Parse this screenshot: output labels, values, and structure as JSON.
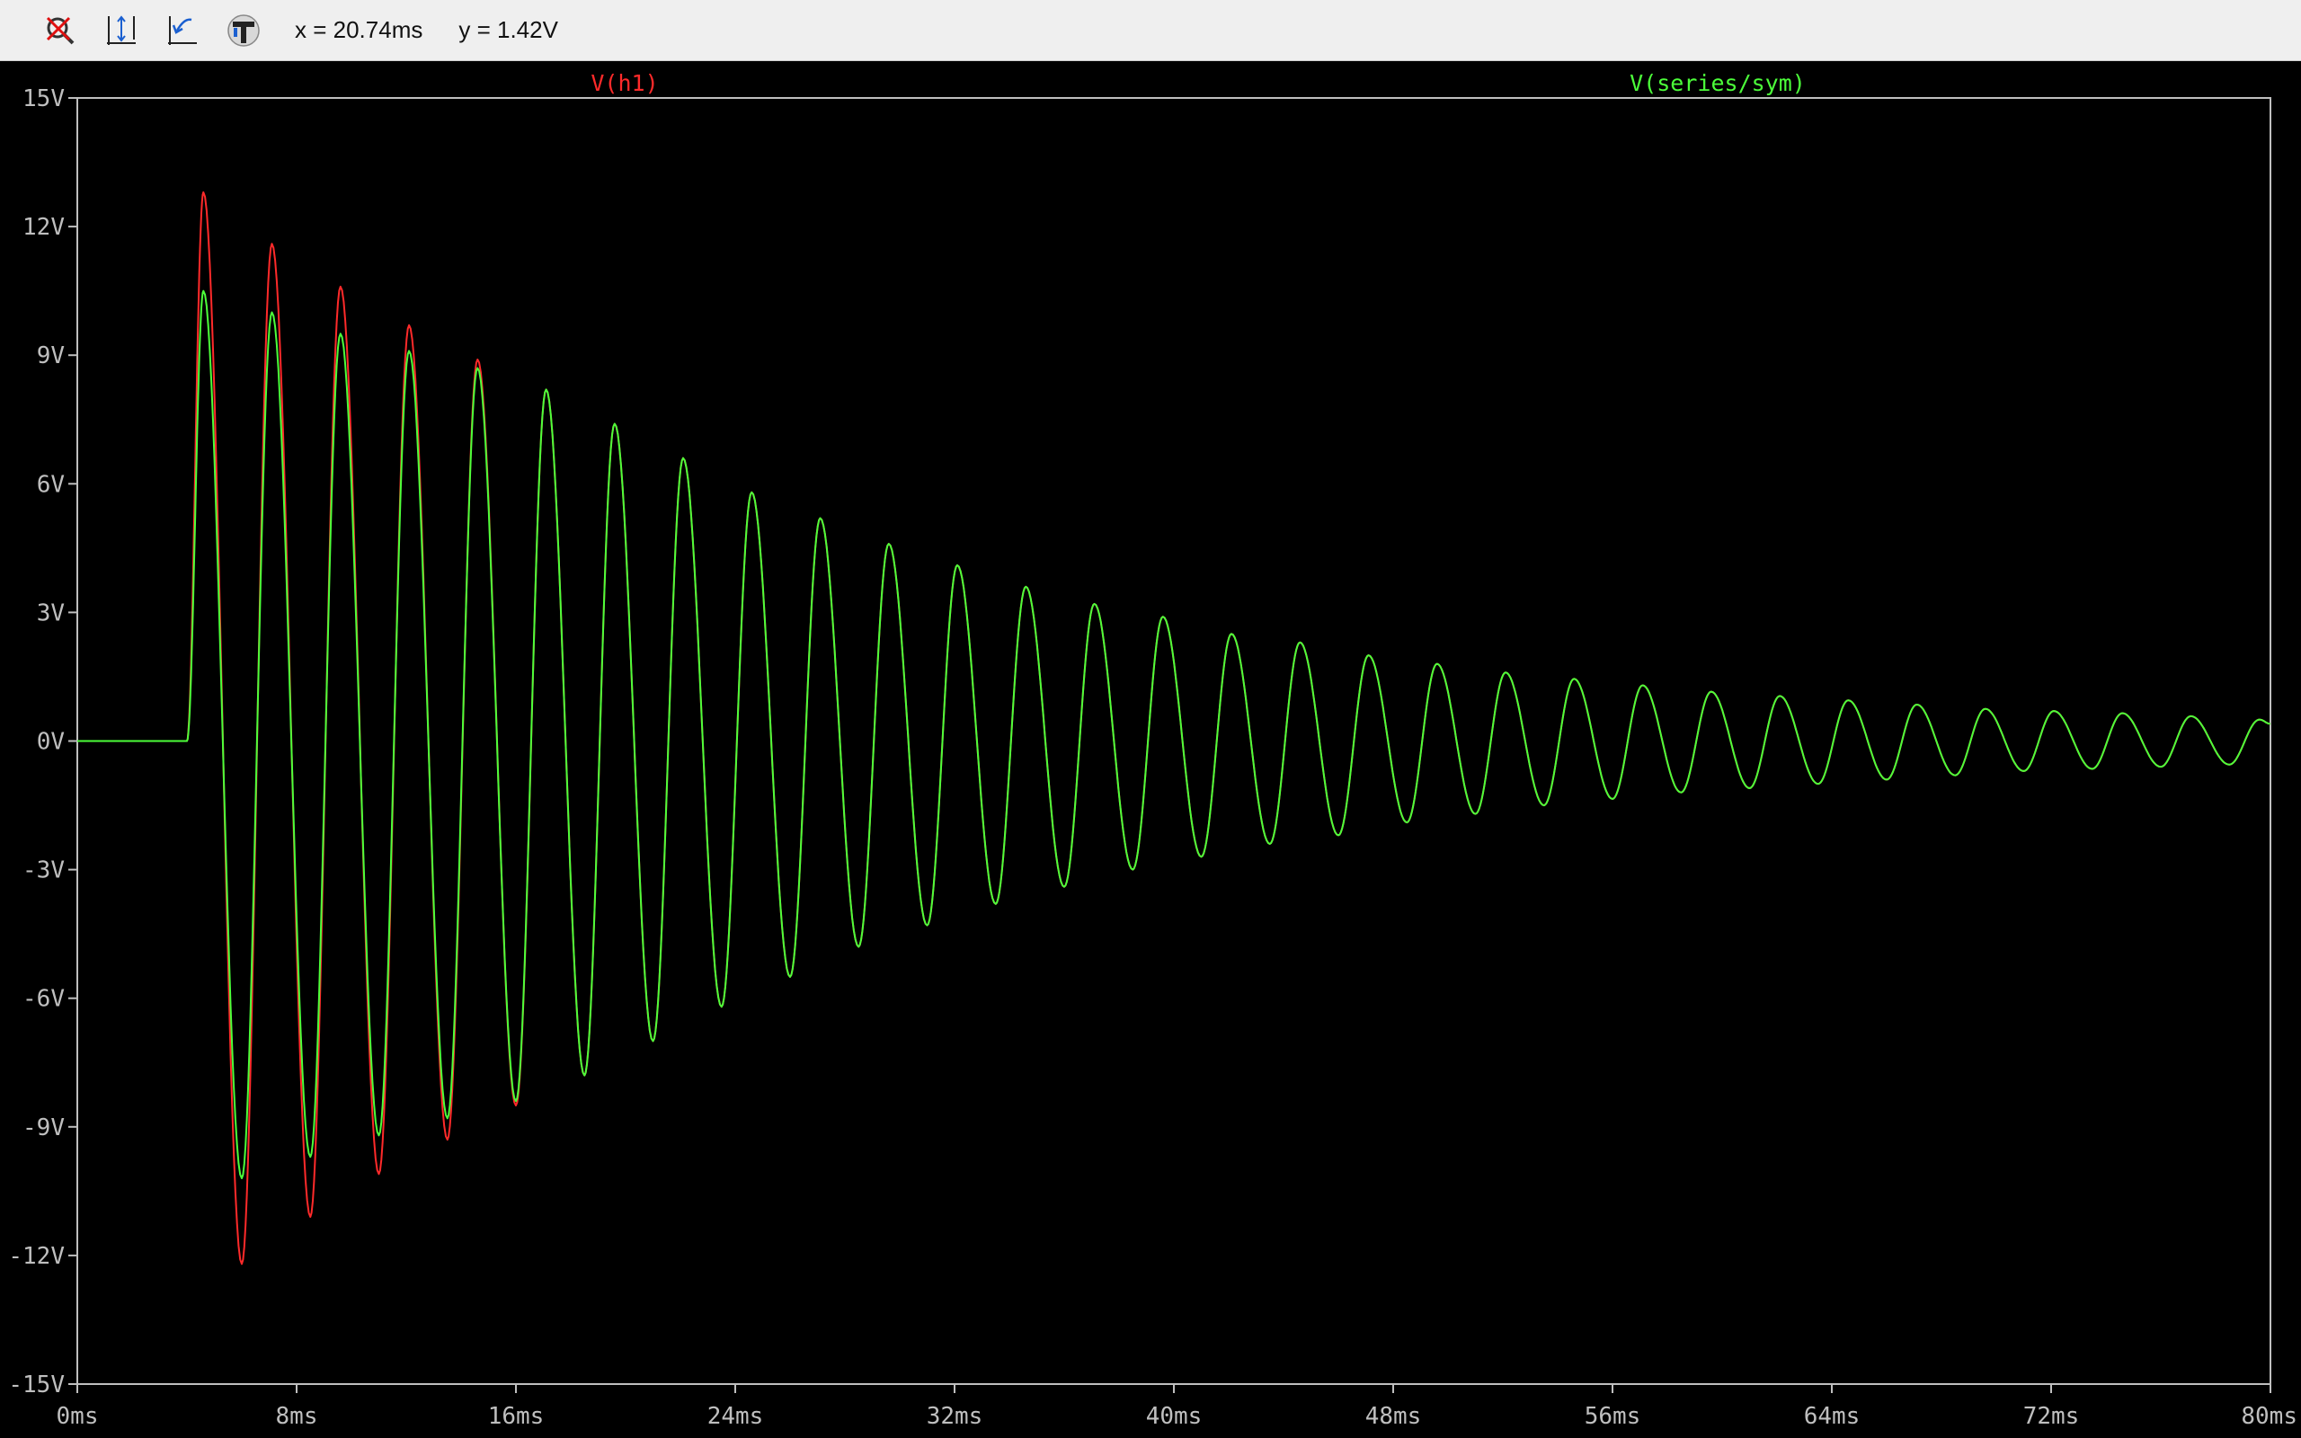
{
  "toolbar": {
    "buttons": [
      {
        "icon": "zoom-reset-icon",
        "name": "zoom-reset-button"
      },
      {
        "icon": "autorange-icon",
        "name": "autorange-button"
      },
      {
        "icon": "zoom-back-icon",
        "name": "zoom-back-button"
      },
      {
        "icon": "pick-traces-icon",
        "name": "pick-traces-button"
      }
    ],
    "cursor_x": "x = 20.74ms",
    "cursor_y": "y = 1.42V"
  },
  "colors": {
    "background": "#000000",
    "axis": "#bfbfbf",
    "trace1": "#ff2a2a",
    "trace2": "#4cff3a"
  },
  "chart_data": {
    "type": "line",
    "title": "",
    "xlabel": "",
    "ylabel": "",
    "xlim": [
      0,
      80
    ],
    "ylim": [
      -15,
      15
    ],
    "x_unit": "ms",
    "y_unit": "V",
    "x_ticks": [
      "0ms",
      "8ms",
      "16ms",
      "24ms",
      "32ms",
      "40ms",
      "48ms",
      "56ms",
      "64ms",
      "72ms",
      "80ms"
    ],
    "y_ticks": [
      "15V",
      "12V",
      "9V",
      "6V",
      "3V",
      "0V",
      "-3V",
      "-6V",
      "-9V",
      "-12V",
      "-15V"
    ],
    "grid": false,
    "legend_position": "top",
    "series": [
      {
        "name": "V(h1)",
        "color": "#ff2a2a",
        "points": [
          [
            0,
            0
          ],
          [
            4,
            0
          ],
          [
            4.6,
            12.8
          ],
          [
            6,
            -12.2
          ],
          [
            7.1,
            11.6
          ],
          [
            8.5,
            -11.1
          ],
          [
            9.6,
            10.6
          ],
          [
            11,
            -10.1
          ],
          [
            12.1,
            9.7
          ],
          [
            13.5,
            -9.3
          ],
          [
            14.6,
            8.9
          ],
          [
            16,
            -8.5
          ],
          [
            17.1,
            8.2
          ],
          [
            18.5,
            -7.8
          ],
          [
            19.6,
            7.4
          ],
          [
            21,
            -7.0
          ],
          [
            22.1,
            6.6
          ],
          [
            23.5,
            -6.2
          ],
          [
            24.6,
            5.8
          ],
          [
            26,
            -5.5
          ],
          [
            27.1,
            5.2
          ],
          [
            28.5,
            -4.8
          ],
          [
            29.6,
            4.6
          ],
          [
            31,
            -4.3
          ],
          [
            32.1,
            4.1
          ],
          [
            33.5,
            -3.8
          ],
          [
            34.6,
            3.6
          ],
          [
            36,
            -3.4
          ],
          [
            37.1,
            3.2
          ],
          [
            38.5,
            -3.0
          ],
          [
            39.6,
            2.9
          ],
          [
            41,
            -2.7
          ],
          [
            42.1,
            2.5
          ],
          [
            43.5,
            -2.4
          ],
          [
            44.6,
            2.3
          ],
          [
            46,
            -2.2
          ],
          [
            47.1,
            2.0
          ],
          [
            48.5,
            -1.9
          ],
          [
            49.6,
            1.8
          ],
          [
            51,
            -1.7
          ],
          [
            52.1,
            1.6
          ],
          [
            53.5,
            -1.5
          ],
          [
            54.6,
            1.45
          ],
          [
            56,
            -1.35
          ],
          [
            57.1,
            1.3
          ],
          [
            58.5,
            -1.2
          ],
          [
            59.6,
            1.15
          ],
          [
            61,
            -1.1
          ],
          [
            62.1,
            1.05
          ],
          [
            63.5,
            -1.0
          ],
          [
            64.6,
            0.95
          ],
          [
            66,
            -0.9
          ],
          [
            67.1,
            0.85
          ],
          [
            68.5,
            -0.8
          ],
          [
            69.6,
            0.75
          ],
          [
            71,
            -0.7
          ],
          [
            72.1,
            0.7
          ],
          [
            73.5,
            -0.65
          ],
          [
            74.6,
            0.65
          ],
          [
            76,
            -0.6
          ],
          [
            77.1,
            0.58
          ],
          [
            78.5,
            -0.55
          ],
          [
            79.6,
            0.5
          ],
          [
            80,
            0.4
          ]
        ]
      },
      {
        "name": "V(series/sym)",
        "color": "#4cff3a",
        "points": [
          [
            0,
            0
          ],
          [
            4,
            0
          ],
          [
            4.6,
            10.5
          ],
          [
            6,
            -10.2
          ],
          [
            7.1,
            10.0
          ],
          [
            8.5,
            -9.7
          ],
          [
            9.6,
            9.5
          ],
          [
            11,
            -9.2
          ],
          [
            12.1,
            9.1
          ],
          [
            13.5,
            -8.8
          ],
          [
            14.6,
            8.7
          ],
          [
            16,
            -8.4
          ],
          [
            17.1,
            8.2
          ],
          [
            18.5,
            -7.8
          ],
          [
            19.6,
            7.4
          ],
          [
            21,
            -7.0
          ],
          [
            22.1,
            6.6
          ],
          [
            23.5,
            -6.2
          ],
          [
            24.6,
            5.8
          ],
          [
            26,
            -5.5
          ],
          [
            27.1,
            5.2
          ],
          [
            28.5,
            -4.8
          ],
          [
            29.6,
            4.6
          ],
          [
            31,
            -4.3
          ],
          [
            32.1,
            4.1
          ],
          [
            33.5,
            -3.8
          ],
          [
            34.6,
            3.6
          ],
          [
            36,
            -3.4
          ],
          [
            37.1,
            3.2
          ],
          [
            38.5,
            -3.0
          ],
          [
            39.6,
            2.9
          ],
          [
            41,
            -2.7
          ],
          [
            42.1,
            2.5
          ],
          [
            43.5,
            -2.4
          ],
          [
            44.6,
            2.3
          ],
          [
            46,
            -2.2
          ],
          [
            47.1,
            2.0
          ],
          [
            48.5,
            -1.9
          ],
          [
            49.6,
            1.8
          ],
          [
            51,
            -1.7
          ],
          [
            52.1,
            1.6
          ],
          [
            53.5,
            -1.5
          ],
          [
            54.6,
            1.45
          ],
          [
            56,
            -1.35
          ],
          [
            57.1,
            1.3
          ],
          [
            58.5,
            -1.2
          ],
          [
            59.6,
            1.15
          ],
          [
            61,
            -1.1
          ],
          [
            62.1,
            1.05
          ],
          [
            63.5,
            -1.0
          ],
          [
            64.6,
            0.95
          ],
          [
            66,
            -0.9
          ],
          [
            67.1,
            0.85
          ],
          [
            68.5,
            -0.8
          ],
          [
            69.6,
            0.75
          ],
          [
            71,
            -0.7
          ],
          [
            72.1,
            0.7
          ],
          [
            73.5,
            -0.65
          ],
          [
            74.6,
            0.65
          ],
          [
            76,
            -0.6
          ],
          [
            77.1,
            0.58
          ],
          [
            78.5,
            -0.55
          ],
          [
            79.6,
            0.5
          ],
          [
            80,
            0.4
          ]
        ]
      }
    ]
  }
}
